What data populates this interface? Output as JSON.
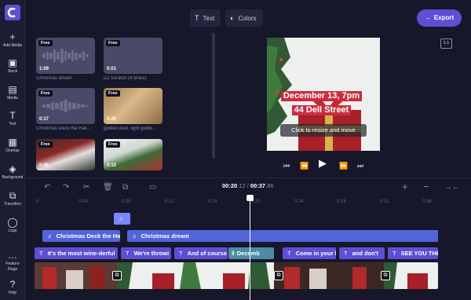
{
  "nav": {
    "items": [
      {
        "label": "Add Media",
        "icon": "plus-icon",
        "glyph": "+"
      },
      {
        "label": "Stock",
        "icon": "stock-icon",
        "glyph": "▣"
      },
      {
        "label": "Media",
        "icon": "media-icon",
        "glyph": "▤"
      },
      {
        "label": "Text",
        "icon": "text-icon",
        "glyph": "T"
      },
      {
        "label": "Overlay",
        "icon": "overlay-icon",
        "glyph": "▦"
      },
      {
        "label": "Background",
        "icon": "background-icon",
        "glyph": "◈"
      },
      {
        "label": "Transition",
        "icon": "transition-icon",
        "glyph": "⧉"
      },
      {
        "label": "Logo",
        "icon": "logo-icon",
        "glyph": "◯"
      },
      {
        "label": "Feature Flags",
        "icon": "more-icon",
        "glyph": "…"
      },
      {
        "label": "Help",
        "icon": "help-icon",
        "glyph": "?"
      }
    ]
  },
  "top": {
    "text_label": "Text",
    "colors_label": "Colors",
    "export_label": "Export"
  },
  "library": {
    "items": [
      {
        "badge": "Free",
        "duration": "1:09",
        "name": "Christmas dream",
        "kind": "audio"
      },
      {
        "badge": "Free",
        "duration": "0:01",
        "name": "DJ Scratch (4 times)",
        "kind": "audio"
      },
      {
        "badge": "Free",
        "duration": "0:17",
        "name": "Christmas Deck the Hall...",
        "kind": "audio"
      },
      {
        "badge": "Free",
        "duration": "0:20",
        "name": "golden dust, light golde...",
        "kind": "video"
      },
      {
        "badge": "Free",
        "duration": "0:06",
        "name": "",
        "kind": "video"
      },
      {
        "badge": "Free",
        "duration": "0:10",
        "name": "",
        "kind": "video"
      }
    ]
  },
  "preview": {
    "aspect_ratio": "1:1",
    "caption_line1": "December 13, 7pm",
    "caption_line2": "44 Dell Street",
    "resize_hint": "Click to resize and move"
  },
  "playback": {
    "current_time_main": "00:20",
    "current_time_frac": ".12",
    "separator": " / ",
    "total_time_main": "00:37",
    "total_time_frac": ".86"
  },
  "ruler": {
    "ticks": [
      "0",
      "0:04",
      "0:08",
      "0:12",
      "0:16",
      "0:20",
      "0:24",
      "0:28",
      "0:32",
      "0:36"
    ]
  },
  "timeline": {
    "music_clips": [
      {
        "label": "Christmas Deck the Ha"
      },
      {
        "label": "Christmas dream"
      }
    ],
    "text_clips": [
      {
        "label": "It's the most wine-derful"
      },
      {
        "label": "We're throwi"
      },
      {
        "label": "And of course"
      },
      {
        "label": "Decemb"
      },
      {
        "label": "Come in your b"
      },
      {
        "label": "and don't"
      },
      {
        "label": "SEE YOU THE"
      }
    ]
  },
  "colors": {
    "accent": "#5b4fd6",
    "text_clip": "#5d4fd2",
    "music_clip": "#5364d9",
    "caption_bg": "#c92e3f"
  }
}
